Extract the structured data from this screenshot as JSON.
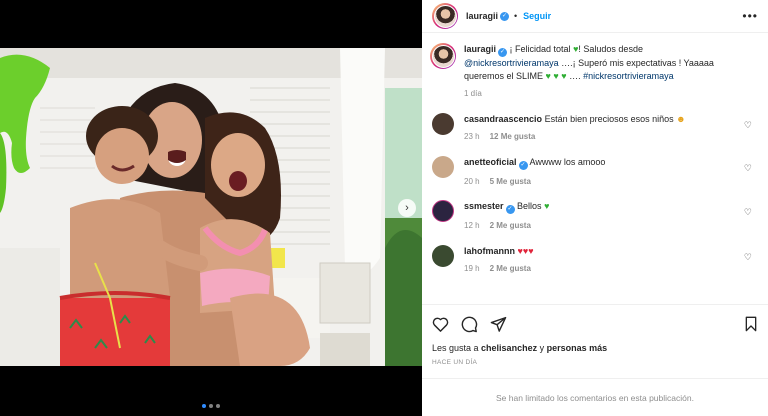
{
  "header": {
    "username": "lauragii",
    "follow_label": "Seguir"
  },
  "caption": {
    "username": "lauragii",
    "text_1": "¡ Felicidad total ",
    "text_2": "! Saludos desde ",
    "mention": "@nickresortrivieramaya",
    "text_3": " ….¡ Superó mis expectativas ! Yaaaaa queremos el SLIME ",
    "text_4": " …. ",
    "hashtag": "#nickresortrivieramaya",
    "time": "1 día"
  },
  "comments": [
    {
      "username": "casandraascencio",
      "text": "Están bien preciosos esos niños ",
      "time": "23 h",
      "likes": "12 Me gusta",
      "avatar_color": "#4a3a30"
    },
    {
      "username": "anetteoficial",
      "text": "Awwww los amooo",
      "time": "20 h",
      "likes": "5 Me gusta",
      "avatar_color": "#c9a88a"
    },
    {
      "username": "ssmester",
      "text": "Bellos ",
      "time": "12 h",
      "likes": "2 Me gusta",
      "avatar_color": "#2b2440"
    },
    {
      "username": "lahofmannn",
      "text": "",
      "time": "19 h",
      "likes": "2 Me gusta",
      "avatar_color": "#3a4a30"
    }
  ],
  "likes": {
    "prefix": "Les gusta a ",
    "user": "chelisanchez",
    "joiner": " y ",
    "others": "personas más"
  },
  "post_date": "HACE UN DÍA",
  "comments_disabled": "Se han limitado los comentarios en esta publicación.",
  "carousel": {
    "total": 3,
    "active": 1
  },
  "icons": {
    "verified": "verified-badge-icon",
    "more": "more-options-icon",
    "like": "heart-icon",
    "comment": "comment-bubble-icon",
    "share": "paper-plane-icon",
    "save": "bookmark-icon"
  },
  "colors": {
    "accent": "#0095f6",
    "verified": "#3897f0",
    "slime_green": "#6ccf2c"
  }
}
